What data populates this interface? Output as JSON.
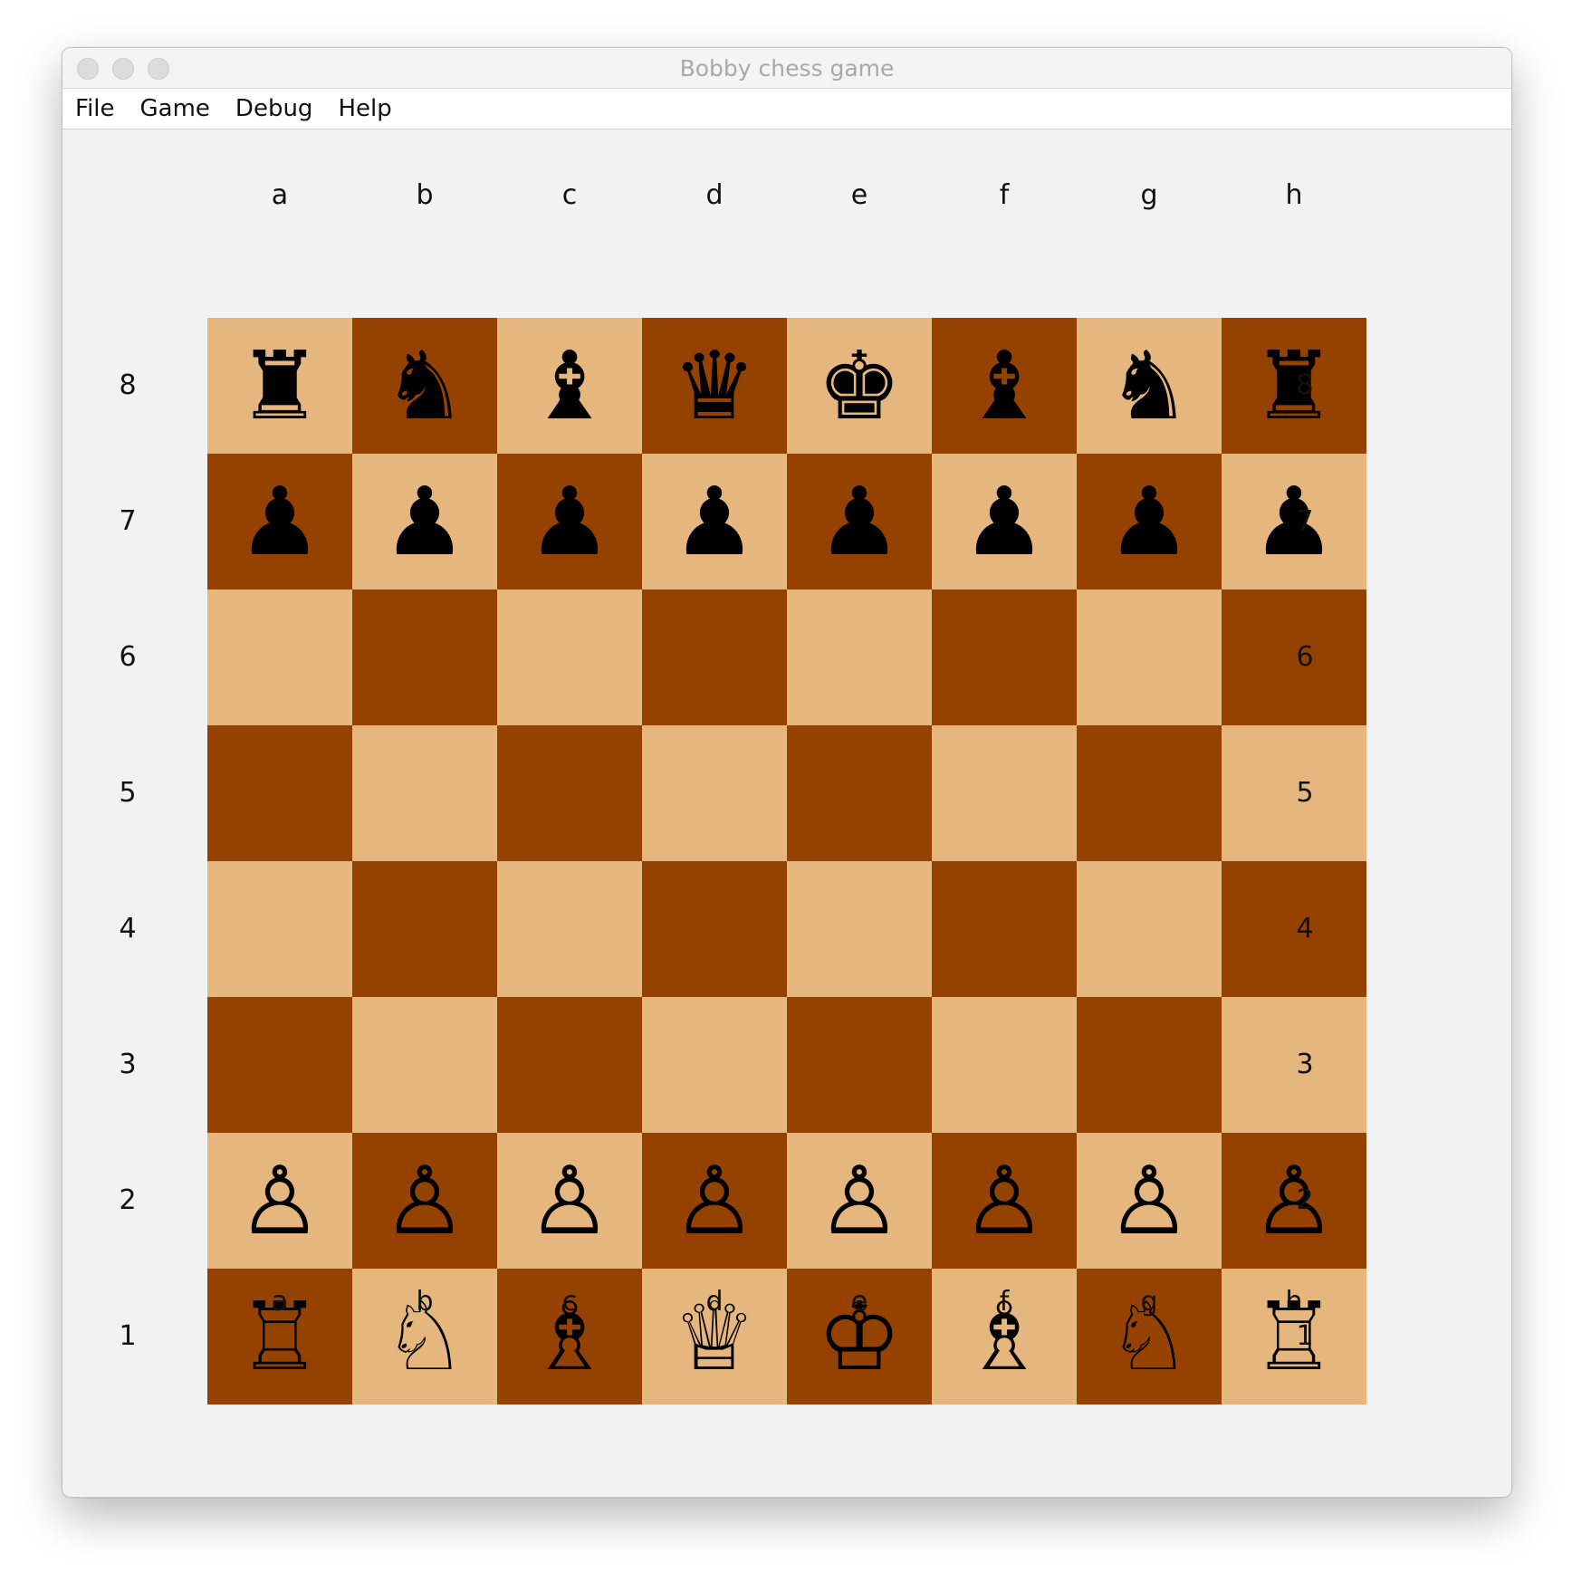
{
  "window": {
    "title": "Bobby chess game"
  },
  "menu": [
    {
      "label": "File"
    },
    {
      "label": "Game"
    },
    {
      "label": "Debug"
    },
    {
      "label": "Help"
    }
  ],
  "board": {
    "files": [
      "a",
      "b",
      "c",
      "d",
      "e",
      "f",
      "g",
      "h"
    ],
    "ranks": [
      "8",
      "7",
      "6",
      "5",
      "4",
      "3",
      "2",
      "1"
    ],
    "colors": {
      "light": "#e5b77f",
      "dark": "#954200"
    },
    "position": [
      [
        "black-rook",
        "black-knight",
        "black-bishop",
        "black-queen",
        "black-king",
        "black-bishop",
        "black-knight",
        "black-rook"
      ],
      [
        "black-pawn",
        "black-pawn",
        "black-pawn",
        "black-pawn",
        "black-pawn",
        "black-pawn",
        "black-pawn",
        "black-pawn"
      ],
      [
        "",
        "",
        "",
        "",
        "",
        "",
        "",
        ""
      ],
      [
        "",
        "",
        "",
        "",
        "",
        "",
        "",
        ""
      ],
      [
        "",
        "",
        "",
        "",
        "",
        "",
        "",
        ""
      ],
      [
        "",
        "",
        "",
        "",
        "",
        "",
        "",
        ""
      ],
      [
        "white-pawn",
        "white-pawn",
        "white-pawn",
        "white-pawn",
        "white-pawn",
        "white-pawn",
        "white-pawn",
        "white-pawn"
      ],
      [
        "white-rook",
        "white-knight",
        "white-bishop",
        "white-queen",
        "white-king",
        "white-bishop",
        "white-knight",
        "white-rook"
      ]
    ]
  }
}
